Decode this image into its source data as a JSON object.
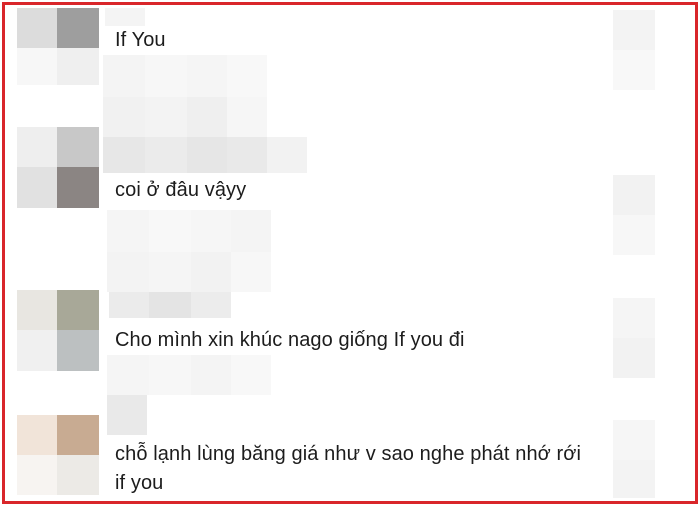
{
  "comments": [
    {
      "text": "If You"
    },
    {
      "text": "coi ở đâu vậyy"
    },
    {
      "text": "Cho mình xin khúc nago giống If you đi"
    },
    {
      "text": "chỗ lạnh lùng băng giá như v sao nghe phát nhớ rới"
    },
    {
      "text": "if you"
    }
  ],
  "colors": {
    "frame_border": "#d9262a",
    "text": "#1c1c1c"
  }
}
